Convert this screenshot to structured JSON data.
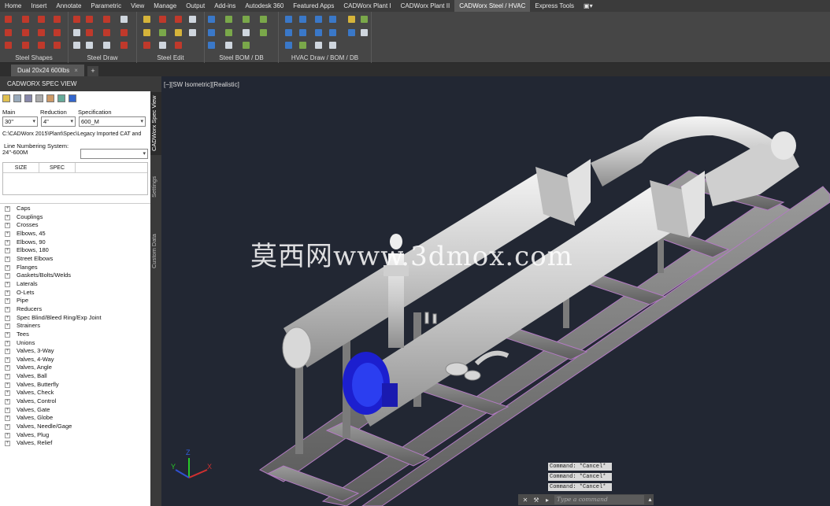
{
  "menu": {
    "tabs": [
      "Home",
      "Insert",
      "Annotate",
      "Parametric",
      "View",
      "Manage",
      "Output",
      "Add-ins",
      "Autodesk 360",
      "Featured Apps",
      "CADWorx Plant I",
      "CADWorx Plant II",
      "CADWorx Steel / HVAC",
      "Express Tools"
    ],
    "active": "CADWorx Steel / HVAC",
    "extra": "▣▾"
  },
  "ribbon": {
    "groups": [
      "Steel Shapes",
      "Steel Draw",
      "Steel Edit",
      "Steel BOM / DB",
      "HVAC Draw / BOM / DB"
    ]
  },
  "document_tab": {
    "label": "Dual 20x24 600lbs",
    "close": "×",
    "add": "+"
  },
  "panel": {
    "title": "CADWORX SPEC VIEW",
    "main_label": "Main",
    "reduction_label": "Reduction",
    "spec_label": "Specification",
    "main_value": "30\"",
    "reduction_value": "4\"",
    "spec_value": "600_M",
    "path": "C:\\CADWorx 2015\\Plant\\Spec\\Legacy Imported CAT and",
    "line_numbering_label": "Line Numbering System:",
    "line_numbering_value": "24\"-600M",
    "table_headers": [
      "SIZE",
      "SPEC"
    ],
    "tree_items": [
      "Caps",
      "Couplings",
      "Crosses",
      "Elbows, 45",
      "Elbows, 90",
      "Elbows, 180",
      "Street Elbows",
      "Flanges",
      "Gaskets/Bolts/Welds",
      "Laterals",
      "O-Lets",
      "Pipe",
      "Reducers",
      "Spec Blind/Bleed Ring/Exp Joint",
      "Strainers",
      "Tees",
      "Unions",
      "Valves, 3-Way",
      "Valves, 4-Way",
      "Valves, Angle",
      "Valves, Ball",
      "Valves, Butterfly",
      "Valves, Check",
      "Valves, Control",
      "Valves, Gate",
      "Valves, Globe",
      "Valves, Needle/Gage",
      "Valves, Plug",
      "Valves, Relief"
    ]
  },
  "side_tabs": [
    "CADWorx Spec View",
    "Settings",
    "Custom Data"
  ],
  "viewport": {
    "label": "[−][SW Isometric][Realistic]",
    "watermark": "莫西网www.3dmox.com",
    "command_history": [
      "Command: *Cancel*",
      "Command: *Cancel*",
      "Command: *Cancel*"
    ],
    "command_placeholder": "Type a command",
    "ucs_labels": {
      "x": "X",
      "y": "Y",
      "z": "Z"
    }
  }
}
